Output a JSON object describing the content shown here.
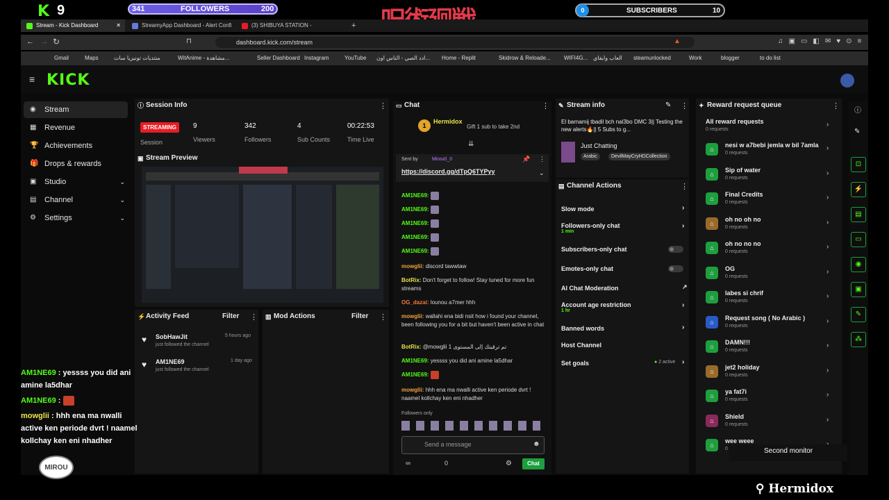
{
  "overlay": {
    "k_logo": "K",
    "k_num": "9",
    "followers_current": "341",
    "followers_label": "FOLLOWERS",
    "followers_goal": "200",
    "subs_current": "0",
    "subs_label": "SUBSCRIBERS",
    "subs_goal": "10",
    "title_jp": "呪術廻戦",
    "chat": [
      {
        "user": "AM1NE69",
        "text": "yessss you did ani"
      },
      {
        "user": "",
        "text": "amine la5dhar"
      },
      {
        "user": "AM1NE69",
        "text": ""
      },
      {
        "user": "mowglii",
        "text": "hhh ena ma nwalli"
      },
      {
        "user": "",
        "text": "active ken periode dvrt ! naamel"
      },
      {
        "user": "",
        "text": "kollchay ken eni nhadher"
      }
    ],
    "mirou": "MIROU",
    "bottom_brand": "Hermidox",
    "second_monitor": "Second monitor"
  },
  "browser": {
    "tabs": [
      "Stream - Kick Dashboard",
      "StreamyApp Dashboard - Alert Confi",
      "(3) SHIBUYA STATION -"
    ],
    "new_tab": "+",
    "url": "dashboard.kick.com/stream",
    "bookmarks": [
      "Gmail",
      "Maps",
      "منتديات تونيزيا سات",
      "WitAnime - مشاهدة...",
      "Seller Dashboard",
      "Instagram",
      "YouTube",
      "ادد الصي - الناس اون...",
      "Home - Replit",
      "Skidrow & Reloade...",
      "WIFI4G...",
      "العاب وايفاي",
      "steamunlocked",
      "Work",
      "blogger",
      "to do list"
    ]
  },
  "app": {
    "logo": "KICK",
    "nav": [
      {
        "label": "Stream",
        "icon": "◉",
        "chev": ""
      },
      {
        "label": "Revenue",
        "icon": "▦",
        "chev": ""
      },
      {
        "label": "Achievements",
        "icon": "🏆",
        "chev": ""
      },
      {
        "label": "Drops & rewards",
        "icon": "🎁",
        "chev": ""
      },
      {
        "label": "Studio",
        "icon": "▣",
        "chev": "⌄"
      },
      {
        "label": "Channel",
        "icon": "▤",
        "chev": "⌄"
      },
      {
        "label": "Settings",
        "icon": "⚙",
        "chev": "⌄"
      }
    ],
    "session": {
      "title": "Session Info",
      "live": "STREAMING",
      "stats": [
        {
          "value": "9",
          "label": "Viewers"
        },
        {
          "value": "342",
          "label": "Followers"
        },
        {
          "value": "4",
          "label": "Sub Counts"
        },
        {
          "value": "00:22:53",
          "label": "Time Live"
        }
      ],
      "session_label": "Session"
    },
    "preview_title": "Stream Preview",
    "activity": {
      "title": "Activity Feed",
      "filter": "Filter",
      "items": [
        {
          "user": "SobHawJit",
          "action": "just followed the channel",
          "time": "5 hours ago"
        },
        {
          "user": "AM1NE69",
          "action": "just followed the channel",
          "time": "1 day ago"
        }
      ]
    },
    "mod": {
      "title": "Mod Actions",
      "filter": "Filter"
    },
    "chat": {
      "title": "Chat",
      "gift_user": "Hermidox",
      "gift_text": "Gift 1 sub to take 2nd",
      "pinned_by": "Sent by",
      "pinned_user": "Mirou0_0",
      "pinned_link": "https://discord.gg/dTpQ6TYPyy",
      "lines": [
        {
          "user": "AM1NE69:",
          "text": "",
          "cls": "u"
        },
        {
          "user": "AM1NE69:",
          "text": "",
          "cls": "u"
        },
        {
          "user": "AM1NE69:",
          "text": "",
          "cls": "u"
        },
        {
          "user": "AM1NE69:",
          "text": "",
          "cls": "u"
        },
        {
          "user": "AM1NE69:",
          "text": "",
          "cls": "u"
        },
        {
          "user": "mowglii:",
          "text": "discord tawwtaw",
          "cls": "u2"
        },
        {
          "user": "BotRix:",
          "text": "Don't forget to follow! Stay tuned for more fun streams",
          "cls": "u3"
        },
        {
          "user": "OG_dazai:",
          "text": "lounou a7mer hhh",
          "cls": "u4"
        },
        {
          "user": "mowglii:",
          "text": "wallahi ena bidi nsit how i found your channel, been following you for a bit but haven't been active in chat",
          "cls": "u2"
        },
        {
          "user": "BotRix:",
          "text": "@mowglii تم ترقيتك إلى المستوى 1",
          "cls": "u3"
        },
        {
          "user": "AM1NE69:",
          "text": "yessss you did ani amine la5dhar",
          "cls": "u"
        },
        {
          "user": "AM1NE69:",
          "text": "",
          "cls": "u"
        },
        {
          "user": "mowglii:",
          "text": "hhh ena ma nwalli active ken periode dvrt ! naamel kollchay ken eni nhadher",
          "cls": "u2"
        }
      ],
      "followers_only": "Followers only",
      "placeholder": "Send a message",
      "infinity": "∞",
      "count": "0",
      "send": "Chat"
    },
    "stream_info": {
      "title": "Stream info",
      "desc": "El barnamij tbadil bch nal3bo DMC 3|| Testing the new alerts🔥|| 5 Subs to g...",
      "category": "Just Chatting",
      "tags": [
        "Arabic",
        "DevilMayCryHDCollection"
      ]
    },
    "channel_actions": {
      "title": "Channel Actions",
      "items": [
        {
          "label": "Slow mode",
          "sub": "",
          "ctrl": "chev"
        },
        {
          "label": "Followers-only chat",
          "sub": "1 min",
          "ctrl": "chev"
        },
        {
          "label": "Subscribers-only chat",
          "sub": "",
          "ctrl": "toggle"
        },
        {
          "label": "Emotes-only chat",
          "sub": "",
          "ctrl": "toggle"
        },
        {
          "label": "AI Chat Moderation",
          "sub": "",
          "ctrl": "ext"
        },
        {
          "label": "Account age restriction",
          "sub": "1 hr",
          "ctrl": "chev"
        },
        {
          "label": "Banned words",
          "sub": "",
          "ctrl": "chev"
        },
        {
          "label": "Host Channel",
          "sub": "",
          "ctrl": ""
        },
        {
          "label": "Set goals",
          "sub": "",
          "ctrl": "chev"
        }
      ],
      "goals_active": "2 active"
    },
    "rewards": {
      "title": "Reward request queue",
      "all": "All reward requests",
      "all_sub": "0 requests",
      "items": [
        {
          "name": "nesi w a7bebi jemla w bil 7amla",
          "sub": "0 requests",
          "color": "#1e9e3e"
        },
        {
          "name": "Sip of water",
          "sub": "0 requests",
          "color": "#1e9e3e"
        },
        {
          "name": "Final Credits",
          "sub": "0 requests",
          "color": "#1e9e3e"
        },
        {
          "name": "oh no oh no",
          "sub": "0 requests",
          "color": "#9a6a2a"
        },
        {
          "name": "oh no no no",
          "sub": "0 requests",
          "color": "#1e9e3e"
        },
        {
          "name": "OG",
          "sub": "0 requests",
          "color": "#1e9e3e"
        },
        {
          "name": "labes si chrif",
          "sub": "0 requests",
          "color": "#1e9e3e"
        },
        {
          "name": "Request song ( No Arabic )",
          "sub": "0 requests",
          "color": "#2a5ac8"
        },
        {
          "name": "DAMN!!!",
          "sub": "0 requests",
          "color": "#1e9e3e"
        },
        {
          "name": "jet2 holiday",
          "sub": "0 requests",
          "color": "#9a6a2a"
        },
        {
          "name": "ya fat7i",
          "sub": "0 requests",
          "color": "#1e9e3e"
        },
        {
          "name": "Shield",
          "sub": "0 requests",
          "color": "#8a2a5a"
        },
        {
          "name": "wee weee",
          "sub": "0 requests",
          "color": "#1e9e3e"
        }
      ]
    }
  },
  "colors": {
    "accent": "#53fc18",
    "live": "#e81c24"
  }
}
